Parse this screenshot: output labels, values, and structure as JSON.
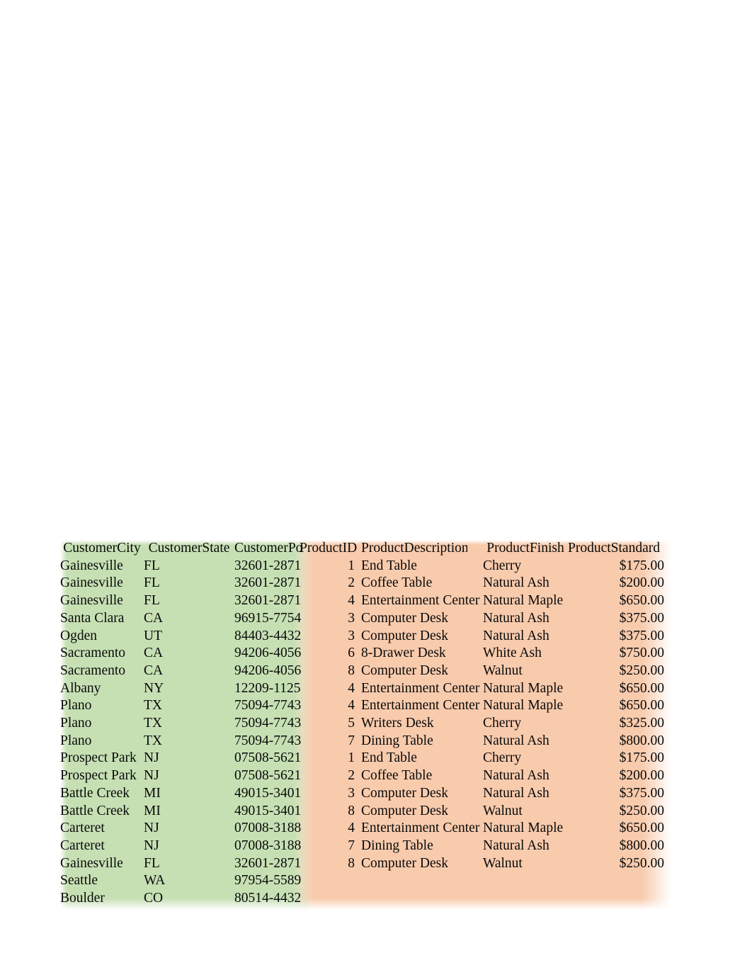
{
  "document": {
    "type": "spreadsheet-range",
    "background_color": "#ffffff",
    "fill_colors": {
      "customer_group": "#c6e0b4",
      "product_group": "#f8cbad"
    }
  },
  "table": {
    "headers": [
      "CustomerCity",
      "CustomerState",
      "CustomerPostalCode",
      "ProductID",
      "ProductDescription",
      "ProductFinish",
      "ProductStandardPrice"
    ],
    "headers_as_displayed": [
      "CustomerCity",
      "CustomerState",
      "CustomerPost",
      "ProductID",
      "ProductDescription",
      "ProductFinish",
      "ProductStandard"
    ],
    "rows": [
      {
        "city": "Gainesville",
        "state": "FL",
        "zip": "32601-2871",
        "product_id": "1",
        "description": "End Table",
        "finish": "Cherry",
        "price": "$175.00"
      },
      {
        "city": "Gainesville",
        "state": "FL",
        "zip": "32601-2871",
        "product_id": "2",
        "description": "Coffee Table",
        "finish": "Natural Ash",
        "price": "$200.00"
      },
      {
        "city": "Gainesville",
        "state": "FL",
        "zip": "32601-2871",
        "product_id": "4",
        "description": "Entertainment Center",
        "finish": "Natural Maple",
        "price": "$650.00"
      },
      {
        "city": "Santa Clara",
        "state": "CA",
        "zip": "96915-7754",
        "product_id": "3",
        "description": "Computer Desk",
        "finish": "Natural Ash",
        "price": "$375.00"
      },
      {
        "city": "Ogden",
        "state": "UT",
        "zip": "84403-4432",
        "product_id": "3",
        "description": "Computer Desk",
        "finish": "Natural Ash",
        "price": "$375.00"
      },
      {
        "city": "Sacramento",
        "state": "CA",
        "zip": "94206-4056",
        "product_id": "6",
        "description": "8-Drawer Desk",
        "finish": "White Ash",
        "price": "$750.00"
      },
      {
        "city": "Sacramento",
        "state": "CA",
        "zip": "94206-4056",
        "product_id": "8",
        "description": "Computer Desk",
        "finish": "Walnut",
        "price": "$250.00"
      },
      {
        "city": "Albany",
        "state": "NY",
        "zip": "12209-1125",
        "product_id": "4",
        "description": "Entertainment Center",
        "finish": "Natural Maple",
        "price": "$650.00"
      },
      {
        "city": "Plano",
        "state": "TX",
        "zip": "75094-7743",
        "product_id": "4",
        "description": "Entertainment Center",
        "finish": "Natural Maple",
        "price": "$650.00"
      },
      {
        "city": "Plano",
        "state": "TX",
        "zip": "75094-7743",
        "product_id": "5",
        "description": "Writers Desk",
        "finish": "Cherry",
        "price": "$325.00"
      },
      {
        "city": "Plano",
        "state": "TX",
        "zip": "75094-7743",
        "product_id": "7",
        "description": "Dining Table",
        "finish": "Natural Ash",
        "price": "$800.00"
      },
      {
        "city": "Prospect Park",
        "state": "NJ",
        "zip": "07508-5621",
        "product_id": "1",
        "description": "End Table",
        "finish": "Cherry",
        "price": "$175.00"
      },
      {
        "city": "Prospect Park",
        "state": "NJ",
        "zip": "07508-5621",
        "product_id": "2",
        "description": "Coffee Table",
        "finish": "Natural Ash",
        "price": "$200.00"
      },
      {
        "city": "Battle Creek",
        "state": "MI",
        "zip": "49015-3401",
        "product_id": "3",
        "description": "Computer Desk",
        "finish": "Natural Ash",
        "price": "$375.00"
      },
      {
        "city": "Battle Creek",
        "state": "MI",
        "zip": "49015-3401",
        "product_id": "8",
        "description": "Computer Desk",
        "finish": "Walnut",
        "price": "$250.00"
      },
      {
        "city": "Carteret",
        "state": "NJ",
        "zip": "07008-3188",
        "product_id": "4",
        "description": "Entertainment Center",
        "finish": "Natural Maple",
        "price": "$650.00"
      },
      {
        "city": "Carteret",
        "state": "NJ",
        "zip": "07008-3188",
        "product_id": "7",
        "description": "Dining Table",
        "finish": "Natural Ash",
        "price": "$800.00"
      },
      {
        "city": "Gainesville",
        "state": "FL",
        "zip": "32601-2871",
        "product_id": "8",
        "description": "Computer Desk",
        "finish": "Walnut",
        "price": "$250.00"
      },
      {
        "city": "Seattle",
        "state": "WA",
        "zip": "97954-5589",
        "product_id": "",
        "description": "",
        "finish": "",
        "price": ""
      },
      {
        "city": "Boulder",
        "state": "CO",
        "zip": "80514-4432",
        "product_id": "",
        "description": "",
        "finish": "",
        "price": ""
      }
    ]
  }
}
